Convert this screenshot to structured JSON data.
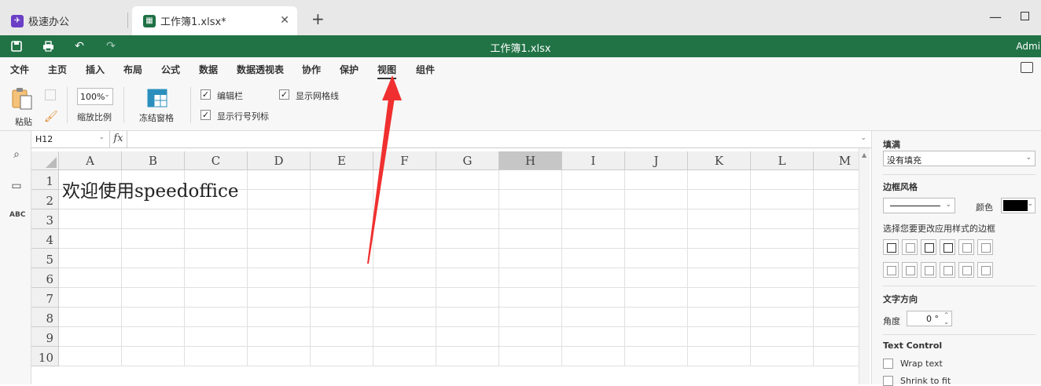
{
  "browser": {
    "tabs": [
      {
        "label": "极速办公",
        "icon": "rocket-icon"
      },
      {
        "label": "工作簿1.xlsx*",
        "icon": "spreadsheet-icon",
        "close": "✕"
      }
    ],
    "new_tab": "+"
  },
  "app": {
    "doc_title": "工作簿1.xlsx",
    "user": "Admini",
    "accent": "#217346"
  },
  "menu": {
    "items": [
      "文件",
      "主页",
      "插入",
      "布局",
      "公式",
      "数据",
      "数据透视表",
      "协作",
      "保护",
      "视图",
      "组件"
    ],
    "active": "视图"
  },
  "toolbar": {
    "paste_label": "粘贴",
    "zoom_value": "100%",
    "zoom_label": "缩放比例",
    "freeze_label": "冻结窗格",
    "formula_bar_label": "编辑栏",
    "gridlines_label": "显示网格线",
    "headings_label": "显示行号列标"
  },
  "formula_bar": {
    "cell_ref": "H12",
    "fx": "fx",
    "value": ""
  },
  "sheet": {
    "columns": [
      "A",
      "B",
      "C",
      "D",
      "E",
      "F",
      "G",
      "H",
      "I",
      "J",
      "K",
      "L",
      "M"
    ],
    "rows": [
      "1",
      "2",
      "3",
      "4",
      "5",
      "6",
      "7",
      "8",
      "9",
      "10"
    ],
    "selected_column": "H",
    "a1_text": "欢迎使用speedoffice"
  },
  "right_panel": {
    "fill_title": "填满",
    "fill_value": "没有填充",
    "border_style_title": "边框风格",
    "color_label": "颜色",
    "border_hint": "选择您要更改应用样式的边框",
    "text_direction_title": "文字方向",
    "angle_label": "角度",
    "angle_value": "0 °",
    "text_control_title": "Text Control",
    "wrap_text": "Wrap text",
    "shrink_to_fit": "Shrink to fit"
  }
}
